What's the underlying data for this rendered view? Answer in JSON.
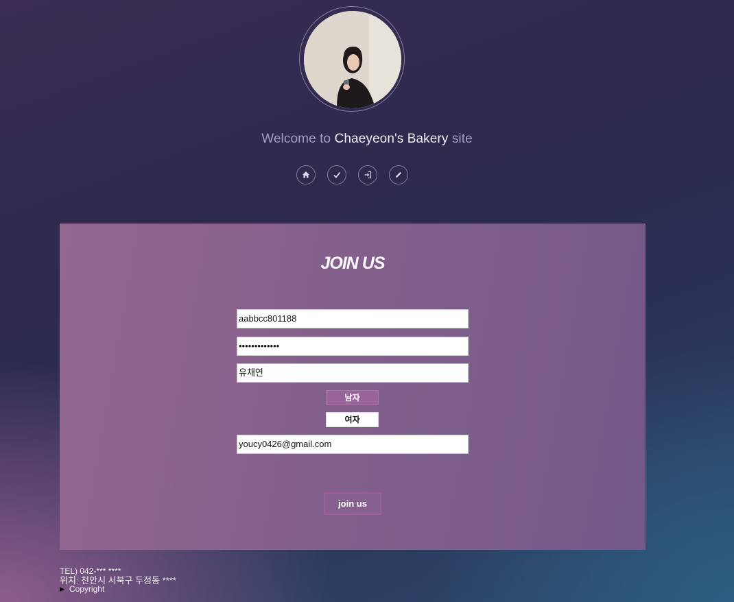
{
  "header": {
    "welcome_prefix": "Welcome to",
    "brand": "Chaeyeon's Bakery",
    "welcome_suffix": "site",
    "nav_icons": [
      "home-icon",
      "check-icon",
      "sign-in-icon",
      "pencil-icon"
    ]
  },
  "form": {
    "title": "JOIN US",
    "user_id": "aabbcc801188",
    "password_masked": "•••••••••••••",
    "name": "유채연",
    "gender_male": "남자",
    "gender_female": "여자",
    "email": "youcy0426@gmail.com",
    "submit_label": "join us"
  },
  "footer": {
    "tel": "TEL) 042-*** ****",
    "address": "위치: 천안시 서북구 두정동 ****",
    "copyright": "Copyright"
  },
  "colors": {
    "panel": "#8a6290",
    "accent": "#99649a"
  }
}
